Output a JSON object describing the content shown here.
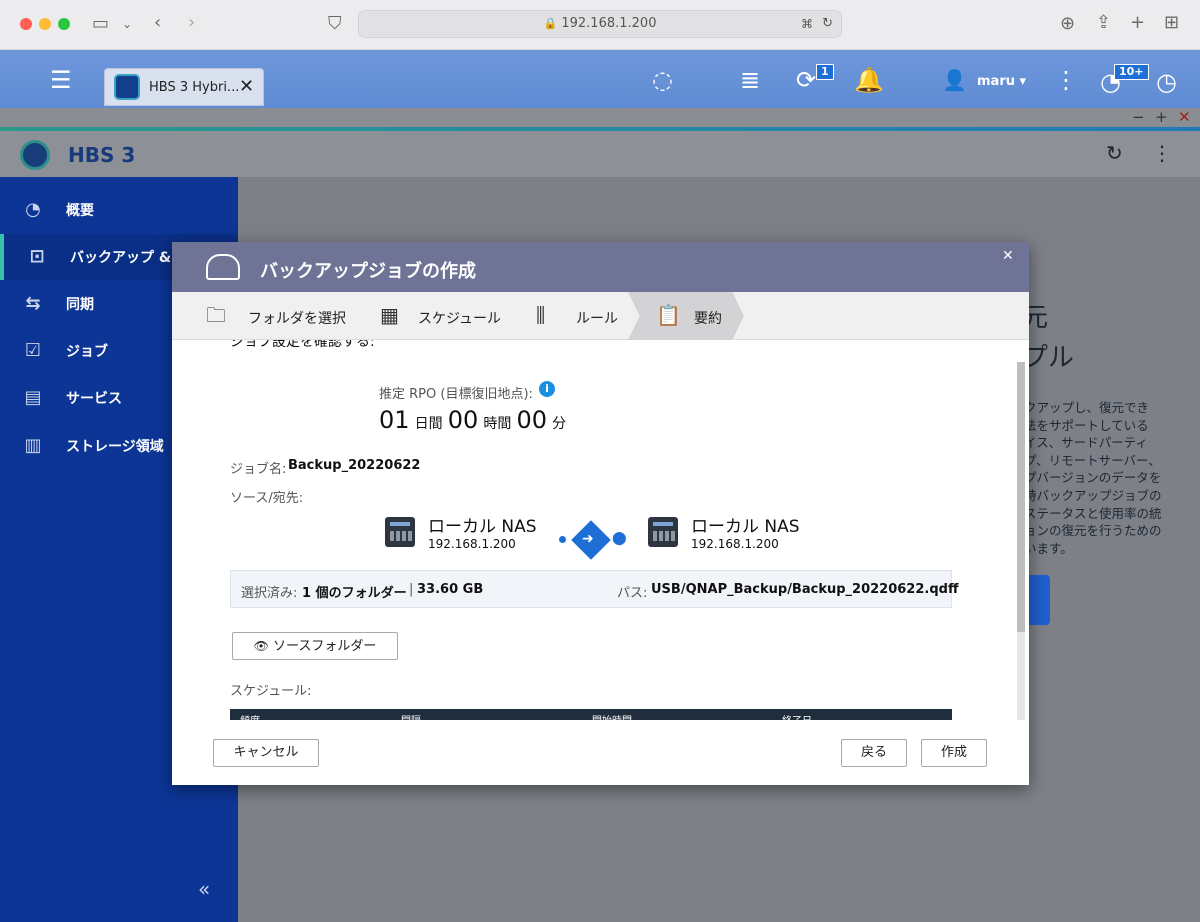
{
  "browser": {
    "url": "192.168.1.200",
    "traffic_colors": [
      "#ff5f57",
      "#febc2e",
      "#28c840"
    ]
  },
  "qts": {
    "tab_title": "HBS 3 Hybri...",
    "notification_badge": "1",
    "user": "maru",
    "alert_badge": "10+",
    "icons": [
      "menu-icon",
      "search-icon",
      "stack-icon",
      "sync-icon",
      "bell-icon",
      "user-icon",
      "more-icon",
      "dashboard-icon",
      "speedometer-icon"
    ]
  },
  "app": {
    "title": "HBS 3",
    "sidebar": [
      {
        "label": "概要",
        "icon": "gauge-icon"
      },
      {
        "label": "バックアップ & 復元",
        "icon": "backup-icon"
      },
      {
        "label": "同期",
        "icon": "sync-icon"
      },
      {
        "label": "ジョブ",
        "icon": "job-icon"
      },
      {
        "label": "サービス",
        "icon": "service-icon"
      },
      {
        "label": "ストレージ領域",
        "icon": "storage-icon"
      }
    ],
    "collapse": "«",
    "bg_lines": [
      "元",
      "プル",
      "クアップし、復元でき",
      "法をサポートしている",
      "イス、サードパーティ",
      "プ、リモートサーバー、",
      "プバージョンのデータを",
      "時バックアップジョブの",
      "ステータスと使用率の統",
      "ョンの復元を行うための",
      "います。"
    ]
  },
  "dialog": {
    "title": "バックアップジョブの作成",
    "steps": [
      {
        "label": "フォルダを選択",
        "icon": "folder-check-icon"
      },
      {
        "label": "スケジュール",
        "icon": "calendar-icon"
      },
      {
        "label": "ルール",
        "icon": "sliders-icon"
      },
      {
        "label": "要約",
        "icon": "clipboard-icon"
      }
    ],
    "heading": "ジョブ設定を確認する:",
    "rpo_label": "推定 RPO (目標復旧地点):",
    "rpo": {
      "days": "01",
      "days_unit": "日間",
      "hours": "00",
      "hours_unit": "時間",
      "mins": "00",
      "mins_unit": "分"
    },
    "job_name_label": "ジョブ名:",
    "job_name": "Backup_20220622",
    "src_dst_label": "ソース/宛先:",
    "source": {
      "name": "ローカル NAS",
      "ip": "192.168.1.200"
    },
    "dest": {
      "name": "ローカル NAS",
      "ip": "192.168.1.200"
    },
    "selected_label": "選択済み:",
    "selected_value": "1 個のフォルダー",
    "size": "33.60 GB",
    "path_label": "パス:",
    "path_value": "USB/QNAP_Backup/Backup_20220622.qdff",
    "source_folder_btn": "ソースフォルダー",
    "schedule_label": "スケジュール:",
    "schedule_headers": [
      "頻度",
      "間隔",
      "開始時間",
      "終了日"
    ],
    "cancel": "キャンセル",
    "back": "戻る",
    "create": "作成"
  }
}
